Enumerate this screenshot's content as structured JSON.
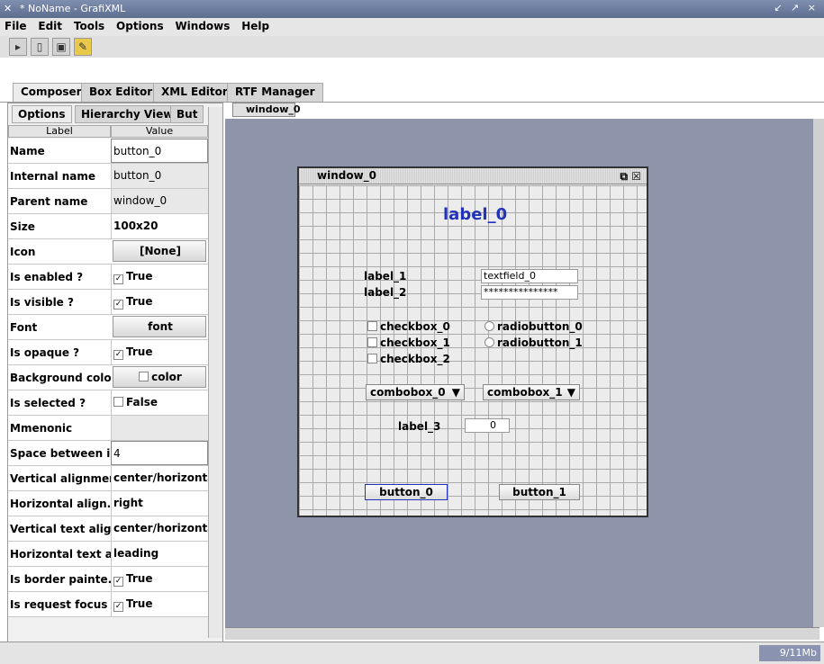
{
  "window": {
    "title": "* NoName - GrafiXML",
    "controls": "↙ ↗ ×"
  },
  "menu": [
    "File",
    "Edit",
    "Tools",
    "Options",
    "Windows",
    "Help"
  ],
  "toolbar": {
    "icons": [
      "open-icon",
      "new-icon",
      "save-icon",
      "edit-icon"
    ]
  },
  "top_tabs": [
    "Composer",
    "Box Editor",
    "XML Editor",
    "RTF Manager"
  ],
  "left_tabs": [
    "Options",
    "Hierarchy View",
    "But"
  ],
  "table": {
    "headers": {
      "label": "Label",
      "value": "Value"
    },
    "rows": [
      {
        "label": "Name",
        "value": "button_0",
        "kind": "edit"
      },
      {
        "label": "Internal name",
        "value": "button_0",
        "kind": "gray"
      },
      {
        "label": "Parent name",
        "value": "window_0",
        "kind": "gray"
      },
      {
        "label": "Size",
        "value": "100x20",
        "kind": "bold"
      },
      {
        "label": "Icon",
        "value": "[None]",
        "kind": "btn"
      },
      {
        "label": "Is enabled ?",
        "value": "True",
        "kind": "check",
        "checked": true
      },
      {
        "label": "Is visible ?",
        "value": "True",
        "kind": "check",
        "checked": true
      },
      {
        "label": "Font",
        "value": "font",
        "kind": "btn"
      },
      {
        "label": "Is opaque ?",
        "value": "True",
        "kind": "check",
        "checked": true
      },
      {
        "label": "Background color",
        "value": "color",
        "kind": "btn"
      },
      {
        "label": "Is selected ?",
        "value": "False",
        "kind": "check",
        "checked": false
      },
      {
        "label": "Mmenonic",
        "value": "",
        "kind": "gray"
      },
      {
        "label": "Space between ic...",
        "value": "4",
        "kind": "edit"
      },
      {
        "label": "Vertical alignment",
        "value": "center/horizontal",
        "kind": "bold"
      },
      {
        "label": "Horizontal align...",
        "value": "right",
        "kind": "bold"
      },
      {
        "label": "Vertical text alig...",
        "value": "center/horizontal",
        "kind": "bold"
      },
      {
        "label": "Horizontal text a...",
        "value": "leading",
        "kind": "bold"
      },
      {
        "label": "Is border painte...",
        "value": "True",
        "kind": "check",
        "checked": true
      },
      {
        "label": "Is request focus ...",
        "value": "True",
        "kind": "check",
        "checked": true
      }
    ]
  },
  "design": {
    "tab": "window_0",
    "window_title": "window_0",
    "label_0": "label_0",
    "label_1": "label_1",
    "label_2": "label_2",
    "textfield_0": "textfield_0",
    "password": "***************",
    "checkbox_0": "checkbox_0",
    "checkbox_1": "checkbox_1",
    "checkbox_2": "checkbox_2",
    "radiobutton_0": "radiobutton_0",
    "radiobutton_1": "radiobutton_1",
    "combobox_0": "combobox_0",
    "combobox_1": "combobox_1",
    "label_3": "label_3",
    "spinner_value": "0",
    "button_0": "button_0",
    "button_1": "button_1"
  },
  "status": {
    "memory": "9/11Mb"
  },
  "colors": {
    "label_0": "#2233bb",
    "design_bg": "#8e95aa"
  }
}
